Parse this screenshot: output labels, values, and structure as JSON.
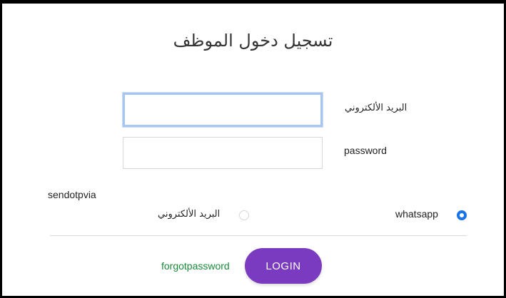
{
  "page": {
    "title": "تسجيل دخول الموظف"
  },
  "form": {
    "email_label": "البريد الألكتروني",
    "email_value": "",
    "password_label": "password",
    "password_value": "",
    "sendotp_label": "sendotpvia",
    "options": [
      {
        "label": "البريد الألكتروني",
        "selected": false
      },
      {
        "label": "whatsapp",
        "selected": true
      }
    ],
    "forgot_label": "forgotpassword",
    "login_label": "LOGIN"
  },
  "colors": {
    "login_button": "#7a3bc0",
    "forgot_link": "#1a8a3a",
    "radio_selected": "#1a73e8",
    "focus_border": "#a7c6f2"
  }
}
